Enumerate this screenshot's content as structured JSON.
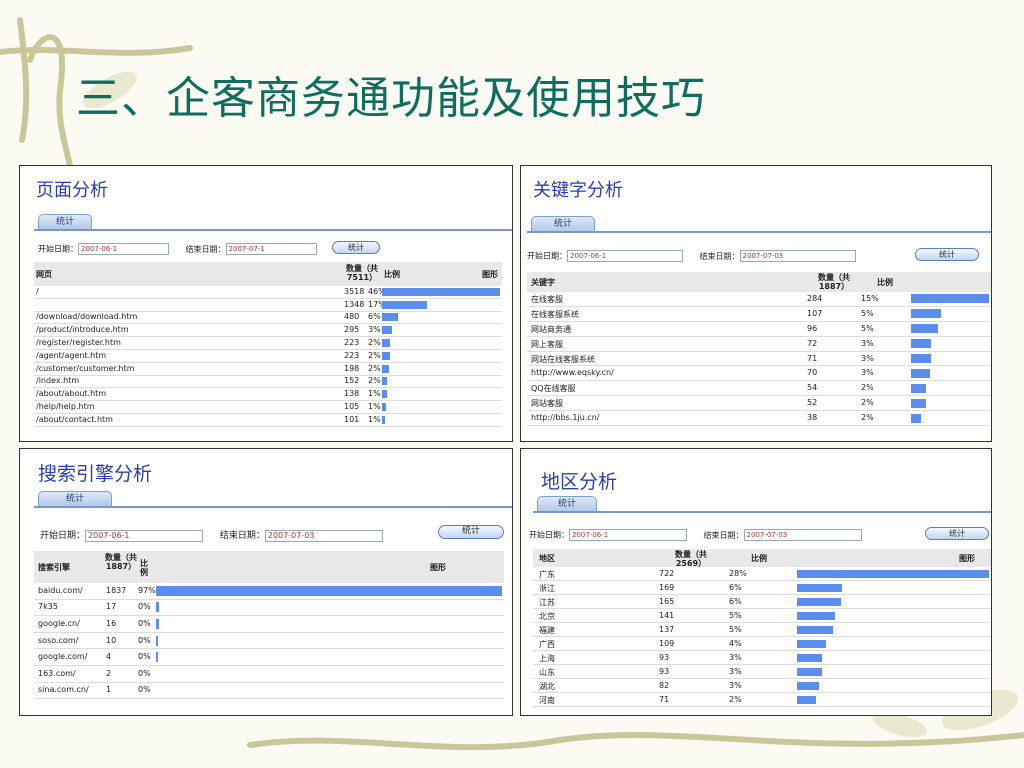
{
  "title": "三、企客商务通功能及使用技巧",
  "colors": {
    "title": "#0e6e5e",
    "panel_title": "#2a3fa8",
    "bar": "#5b8ded",
    "date_value": "#b33333"
  },
  "panels": {
    "page": {
      "title": "页面分析",
      "tab": "统计",
      "start_label": "开始日期：",
      "start_value": "2007-06-1",
      "end_label": "结束日期：",
      "end_value": "2007-07-1",
      "button": "统计",
      "columns": [
        "网页",
        "数量（共7511）",
        "比例",
        "图形"
      ],
      "rows": [
        {
          "name": "/",
          "count": "3518",
          "pct": "46%",
          "share": 0.468
        },
        {
          "name": "",
          "count": "1348",
          "pct": "17%",
          "share": 0.179
        },
        {
          "name": "/download/download.htm",
          "count": "480",
          "pct": "6%",
          "share": 0.064
        },
        {
          "name": "/product/introduce.htm",
          "count": "295",
          "pct": "3%",
          "share": 0.039
        },
        {
          "name": "/register/register.htm",
          "count": "223",
          "pct": "2%",
          "share": 0.03
        },
        {
          "name": "/agent/agent.htm",
          "count": "223",
          "pct": "2%",
          "share": 0.03
        },
        {
          "name": "/customer/customer.htm",
          "count": "198",
          "pct": "2%",
          "share": 0.026
        },
        {
          "name": "/index.htm",
          "count": "152",
          "pct": "2%",
          "share": 0.02
        },
        {
          "name": "/about/about.htm",
          "count": "138",
          "pct": "1%",
          "share": 0.018
        },
        {
          "name": "/help/help.htm",
          "count": "105",
          "pct": "1%",
          "share": 0.014
        },
        {
          "name": "/about/contact.htm",
          "count": "101",
          "pct": "1%",
          "share": 0.013
        }
      ]
    },
    "keyword": {
      "title": "关键字分析",
      "tab": "统计",
      "start_label": "开始日期：",
      "start_value": "2007-06-1",
      "end_label": "结束日期：",
      "end_value": "2007-07-03",
      "button": "统计",
      "columns": [
        "关键字",
        "数量（共1887）",
        "比例",
        ""
      ],
      "rows": [
        {
          "name": "在线客服",
          "count": "284",
          "pct": "15%",
          "share": 0.15
        },
        {
          "name": "在线客服系统",
          "count": "107",
          "pct": "5%",
          "share": 0.057
        },
        {
          "name": "网站商务通",
          "count": "96",
          "pct": "5%",
          "share": 0.051
        },
        {
          "name": "网上客服",
          "count": "72",
          "pct": "3%",
          "share": 0.038
        },
        {
          "name": "网站在线客服系统",
          "count": "71",
          "pct": "3%",
          "share": 0.038
        },
        {
          "name": "http://www.eqsky.cn/",
          "count": "70",
          "pct": "3%",
          "share": 0.037
        },
        {
          "name": "QQ在线客服",
          "count": "54",
          "pct": "2%",
          "share": 0.029
        },
        {
          "name": "网站客服",
          "count": "52",
          "pct": "2%",
          "share": 0.028
        },
        {
          "name": "http://bbs.1ju.cn/",
          "count": "38",
          "pct": "2%",
          "share": 0.02
        }
      ]
    },
    "search": {
      "title": "搜索引擎分析",
      "tab": "统计",
      "start_label": "开始日期：",
      "start_value": "2007-06-1",
      "end_label": "结束日期：",
      "end_value": "2007-07-03",
      "button": "统计",
      "columns": [
        "搜索引擎",
        "数量（共1887）",
        "比例",
        "图形"
      ],
      "rows": [
        {
          "name": "baidu.com/",
          "count": "1837",
          "pct": "97%",
          "share": 0.974
        },
        {
          "name": "7k35",
          "count": "17",
          "pct": "0%",
          "share": 0.009
        },
        {
          "name": "google.cn/",
          "count": "16",
          "pct": "0%",
          "share": 0.008
        },
        {
          "name": "soso.com/",
          "count": "10",
          "pct": "0%",
          "share": 0.005
        },
        {
          "name": "google.com/",
          "count": "4",
          "pct": "0%",
          "share": 0.002
        },
        {
          "name": "163.com/",
          "count": "2",
          "pct": "0%",
          "share": 0.0
        },
        {
          "name": "sina.com.cn/",
          "count": "1",
          "pct": "0%",
          "share": 0.0
        }
      ]
    },
    "region": {
      "title": "地区分析",
      "tab": "统计",
      "start_label": "开始日期：",
      "start_value": "2007-06-1",
      "end_label": "结束日期：",
      "end_value": "2007-07-03",
      "button": "统计",
      "columns": [
        "地区",
        "数量（共2569）",
        "比例",
        "图形"
      ],
      "rows": [
        {
          "name": "广东",
          "count": "722",
          "pct": "28%",
          "share": 0.281
        },
        {
          "name": "浙江",
          "count": "169",
          "pct": "6%",
          "share": 0.066
        },
        {
          "name": "江苏",
          "count": "165",
          "pct": "6%",
          "share": 0.064
        },
        {
          "name": "北京",
          "count": "141",
          "pct": "5%",
          "share": 0.055
        },
        {
          "name": "福建",
          "count": "137",
          "pct": "5%",
          "share": 0.053
        },
        {
          "name": "广西",
          "count": "109",
          "pct": "4%",
          "share": 0.042
        },
        {
          "name": "上海",
          "count": "93",
          "pct": "3%",
          "share": 0.036
        },
        {
          "name": "山东",
          "count": "93",
          "pct": "3%",
          "share": 0.036
        },
        {
          "name": "湖北",
          "count": "82",
          "pct": "3%",
          "share": 0.032
        },
        {
          "name": "河南",
          "count": "71",
          "pct": "2%",
          "share": 0.028
        }
      ]
    }
  }
}
